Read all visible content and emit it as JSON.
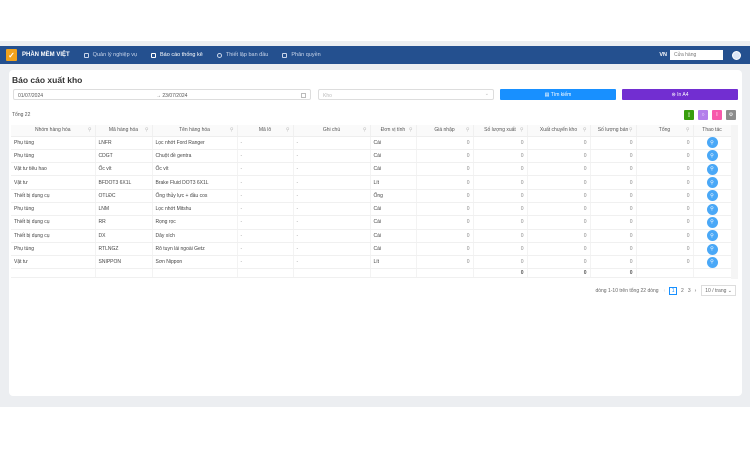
{
  "nav": {
    "brand": "PHẦN MỀM VIỆT",
    "items": [
      {
        "label": "Quản lý nghiệp vụ"
      },
      {
        "label": "Báo cáo thống kê"
      },
      {
        "label": "Thiết lập ban đầu"
      },
      {
        "label": "Phân quyền"
      }
    ],
    "lang": "VN",
    "store_placeholder": "Cửa hàng"
  },
  "page": {
    "title": "Báo cáo xuất kho",
    "date_from": "01/07/2024",
    "date_to": "23/07/2024",
    "kho_placeholder": "Kho",
    "search_label": "Tìm kiếm",
    "print_label": "In A4",
    "total_label": "Tổng 22"
  },
  "colors": {
    "nav": "#24508f",
    "search": "#1890ff",
    "print": "#722ed1",
    "excel": "#389e0d",
    "purple": "#b37feb",
    "pink": "#f759ab",
    "gray": "#8c8c8c"
  },
  "table": {
    "headers": [
      "Nhóm hàng hóa",
      "Mã hàng hóa",
      "Tên hàng hóa",
      "Mã lô",
      "Ghi chú",
      "Đơn vị tính",
      "Giá nhập",
      "Số lượng xuất",
      "Xuất chuyển kho",
      "Số lượng bán",
      "Tổng",
      "Thao tác"
    ],
    "rows": [
      [
        "Phụ tùng",
        "LNFR",
        "Lọc nhớt Ford Ranger",
        "-",
        "-",
        "Cái",
        "0",
        "0",
        "0",
        "0",
        "0"
      ],
      [
        "Phụ tùng",
        "CDGT",
        "Chuột đề gentra",
        "-",
        "-",
        "Cái",
        "0",
        "0",
        "0",
        "0",
        "0"
      ],
      [
        "Vật tư tiêu hao",
        "Ốc vít",
        "Ốc vít",
        "-",
        "-",
        "Cái",
        "0",
        "0",
        "0",
        "0",
        "0"
      ],
      [
        "Vật tư",
        "BFDOT3 6X1L",
        "Brake Fluid DOT3 6X1L",
        "-",
        "-",
        "Lít",
        "0",
        "0",
        "0",
        "0",
        "0"
      ],
      [
        "Thiết bị dụng cụ",
        "OTLĐC",
        "Ống thủy lực + đầu cos",
        "-",
        "-",
        "Ống",
        "0",
        "0",
        "0",
        "0",
        "0"
      ],
      [
        "Phụ tùng",
        "LNM",
        "Lọc nhớt Mitshu",
        "-",
        "-",
        "Cái",
        "0",
        "0",
        "0",
        "0",
        "0"
      ],
      [
        "Thiết bị dụng cụ",
        "RR",
        "Rọng rọc",
        "-",
        "-",
        "Cái",
        "0",
        "0",
        "0",
        "0",
        "0"
      ],
      [
        "Thiết bị dụng cụ",
        "DX",
        "Dây xích",
        "-",
        "-",
        "Cái",
        "0",
        "0",
        "0",
        "0",
        "0"
      ],
      [
        "Phụ tùng",
        "RTLNGZ",
        "Rô tuyn lái ngoài Getz",
        "-",
        "-",
        "Cái",
        "0",
        "0",
        "0",
        "0",
        "0"
      ],
      [
        "Vật tư",
        "SNIPPON",
        "Sơn Nippon",
        "-",
        "-",
        "Lít",
        "0",
        "0",
        "0",
        "0",
        "0"
      ]
    ],
    "summary": {
      "so_luong_xuat": "0",
      "xuat_chuyen_kho": "0",
      "so_luong_ban": "0"
    }
  },
  "pagination": {
    "info": "dòng 1-10 trên tổng 22 dòng",
    "pages": [
      "1",
      "2",
      "3"
    ],
    "current": "1",
    "page_size": "10 / trang"
  }
}
